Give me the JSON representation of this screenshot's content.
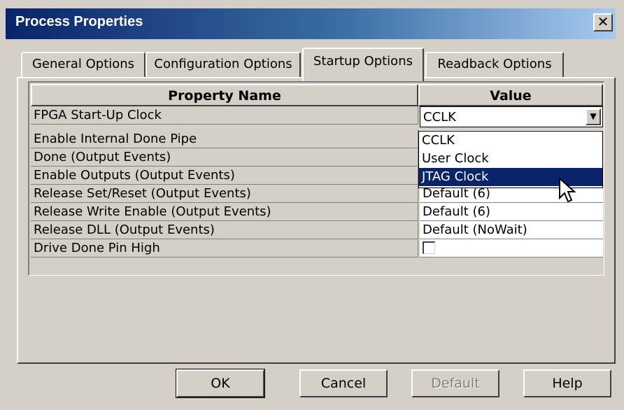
{
  "window": {
    "title": "Process Properties",
    "close_label": "✕"
  },
  "tabs": [
    {
      "label": "General Options",
      "active": false
    },
    {
      "label": "Configuration Options",
      "active": false
    },
    {
      "label": "Startup Options",
      "active": true
    },
    {
      "label": "Readback Options",
      "active": false
    }
  ],
  "grid": {
    "headers": {
      "name": "Property Name",
      "value": "Value"
    },
    "rows": [
      {
        "name": "FPGA Start-Up Clock",
        "value": "CCLK",
        "kind": "combo"
      },
      {
        "name": "Enable Internal Done Pipe",
        "value": ""
      },
      {
        "name": "Done (Output Events)",
        "value": ""
      },
      {
        "name": "Enable Outputs (Output Events)",
        "value": ""
      },
      {
        "name": "Release Set/Reset (Output Events)",
        "value": "Default (6)"
      },
      {
        "name": "Release Write Enable (Output Events)",
        "value": "Default (6)"
      },
      {
        "name": "Release DLL (Output Events)",
        "value": "Default (NoWait)"
      },
      {
        "name": "Drive Done Pin High",
        "value": "",
        "kind": "checkbox",
        "checked": false
      }
    ]
  },
  "dropdown": {
    "options": [
      "CCLK",
      "User Clock",
      "JTAG Clock"
    ],
    "selected_index": 2
  },
  "buttons": {
    "ok": "OK",
    "cancel": "Cancel",
    "default": "Default",
    "help": "Help"
  },
  "colors": {
    "title_start": "#0a246a",
    "title_end": "#a6caf0",
    "selection": "#0a246a",
    "face": "#d4d0c8"
  }
}
